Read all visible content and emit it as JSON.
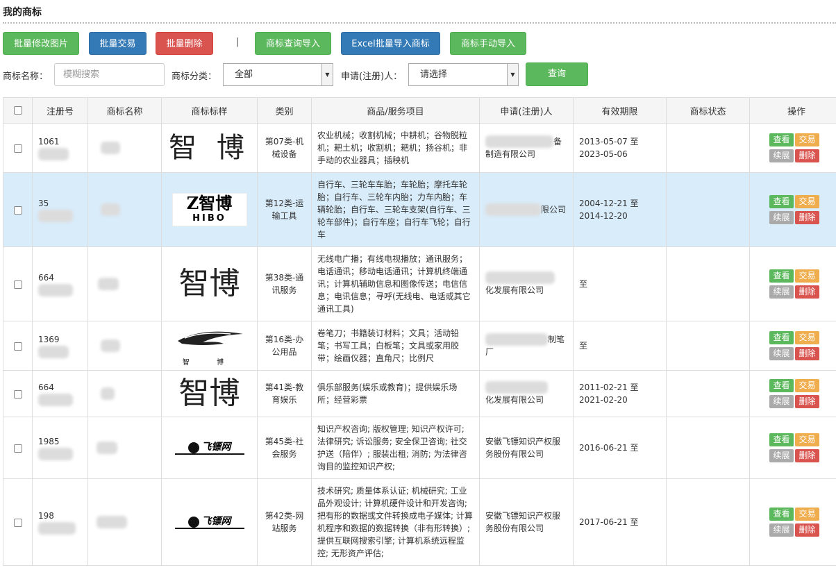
{
  "page": {
    "title": "我的商标"
  },
  "toolbar": {
    "batch_edit_image": "批量修改图片",
    "batch_trade": "批量交易",
    "batch_delete": "批量删除",
    "separator": "|",
    "import_by_query": "商标查询导入",
    "excel_import": "Excel批量导入商标",
    "manual_import": "商标手动导入"
  },
  "filters": {
    "name_label": "商标名称：",
    "name_placeholder": "模糊搜索",
    "category_label": "商标分类：",
    "category_value": "全部",
    "applicant_label": "申请(注册)人：",
    "applicant_value": "请选择",
    "query_button": "查询"
  },
  "table": {
    "headers": [
      "注册号",
      "商标名称",
      "商标标样",
      "类别",
      "商品/服务项目",
      "申请(注册)人",
      "有效期限",
      "商标状态",
      "操作"
    ],
    "actions": {
      "view": "查看",
      "trade": "交易",
      "renew": "续展",
      "delete": "删除"
    },
    "rows": [
      {
        "reg_no": "1061",
        "logo_text": "智 博",
        "category": "第07类-机械设备",
        "goods": "农业机械；收割机械；中耕机；谷物脱粒机；耙土机；收割机；耙机；扬谷机；非手动的农业器具；插秧机",
        "applicant": "备制造有限公司",
        "validity_start": "2013-05-07 至",
        "validity_end": "2023-05-06"
      },
      {
        "reg_no": "35",
        "logo_text": "Z智博",
        "logo_sub": "HIBO",
        "category": "第12类-运输工具",
        "goods": "自行车、三轮车车胎；车轮胎；摩托车轮胎；自行车、三轮车内胎；力车内胎；车辆轮胎；自行车、三轮车支架(自行车、三轮车部件)；自行车座；自行车飞轮；自行车",
        "applicant": "限公司",
        "validity_start": "2004-12-21 至",
        "validity_end": "2014-12-20"
      },
      {
        "reg_no": "664",
        "logo_text": "智博",
        "category": "第38类-通讯服务",
        "goods": "无线电广播；有线电视播放；通讯服务；电话通讯；移动电话通讯；计算机终端通讯；计算机辅助信息和图像传送；电信信息；电讯信息；寻呼(无线电、电话或其它通讯工具)",
        "applicant": "化发展有限公司",
        "validity_start": "至",
        "validity_end": ""
      },
      {
        "reg_no": "1369",
        "logo_text": "智 博",
        "category": "第16类-办公用品",
        "goods": "卷笔刀；书籍装订材料；文具；活动铅笔；书写工具；白板笔；文具或家用胶带；绘画仪器；直角尺；比例尺",
        "applicant": "制笔厂",
        "validity_start": "至",
        "validity_end": ""
      },
      {
        "reg_no": "664",
        "logo_text": "智博",
        "category": "第41类-教育娱乐",
        "goods": "俱乐部服务(娱乐或教育)；提供娱乐场所；经营彩票",
        "applicant": "化发展有限公司",
        "validity_start": "2011-02-21 至",
        "validity_end": "2021-02-20"
      },
      {
        "reg_no": "1985",
        "logo_text": "飞镖网",
        "category": "第45类-社会服务",
        "goods": "知识产权咨询; 版权管理; 知识产权许可; 法律研究; 诉讼服务; 安全保卫咨询; 社交护送（陪伴）; 服装出租; 消防; 为法律咨询目的监控知识产权;",
        "applicant": "安徽飞镖知识产权服务股份有限公司",
        "validity_start": "2016-06-21 至",
        "validity_end": ""
      },
      {
        "reg_no": "198",
        "logo_text": "飞镖网",
        "category": "第42类-网站服务",
        "goods": "技术研究; 质量体系认证; 机械研究; 工业品外观设计; 计算机硬件设计和开发咨询; 把有形的数据或文件转换成电子媒体; 计算机程序和数据的数据转换（非有形转换）; 提供互联网搜索引擎; 计算机系统远程监控; 无形资产评估;",
        "applicant": "安徽飞镖知识产权服务股份有限公司",
        "validity_start": "2017-06-21 至",
        "validity_end": ""
      }
    ]
  }
}
